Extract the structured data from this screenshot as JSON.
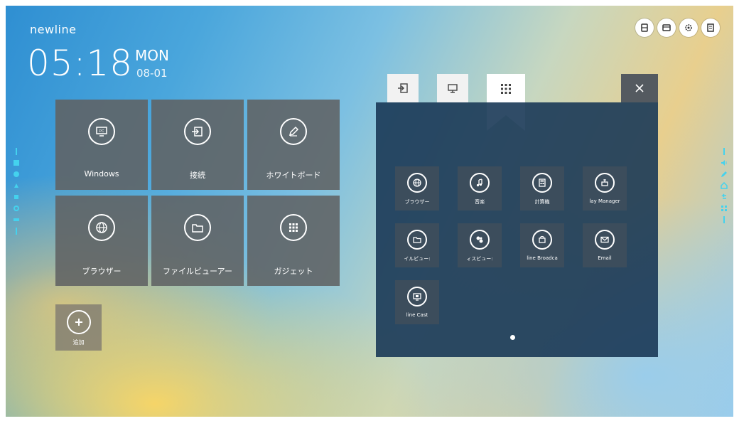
{
  "brand": "newline",
  "clock": {
    "time": "05:18",
    "day": "MON",
    "date": "08-01"
  },
  "tiles": [
    {
      "label": "Windows",
      "icon": "pc-icon"
    },
    {
      "label": "接続",
      "icon": "input-source-icon"
    },
    {
      "label": "ホワイトボード",
      "icon": "pen-icon"
    },
    {
      "label": "ブラウザー",
      "icon": "globe-icon"
    },
    {
      "label": "ファイルビューアー",
      "icon": "folder-icon"
    },
    {
      "label": "ガジェット",
      "icon": "apps-grid-icon"
    }
  ],
  "add_tile": {
    "label": "追加",
    "icon": "plus-icon"
  },
  "top_icons": [
    "storage-icon",
    "window-icon",
    "settings-gear-icon",
    "document-icon"
  ],
  "panel": {
    "tabs": [
      "input-tab-icon",
      "display-tab-icon",
      "apps-tab-icon"
    ],
    "active_tab": 2,
    "apps": [
      {
        "label": "ブラウザー",
        "icon": "globe-icon"
      },
      {
        "label": "音楽",
        "icon": "music-icon"
      },
      {
        "label": "計算機",
        "icon": "calculator-icon"
      },
      {
        "label": "lay Manager",
        "icon": "display-manager-icon"
      },
      {
        "label": "イルビュー:",
        "icon": "folder-icon"
      },
      {
        "label": "ィスビュー:",
        "icon": "photo-icon"
      },
      {
        "label": "line Broadca",
        "icon": "broadcast-icon"
      },
      {
        "label": "Email",
        "icon": "email-icon"
      },
      {
        "label": "line Cast",
        "icon": "cast-icon"
      }
    ]
  },
  "colors": {
    "accent": "#44d2ee",
    "tile_bg": "#606263",
    "panel_bg": "#193856"
  }
}
